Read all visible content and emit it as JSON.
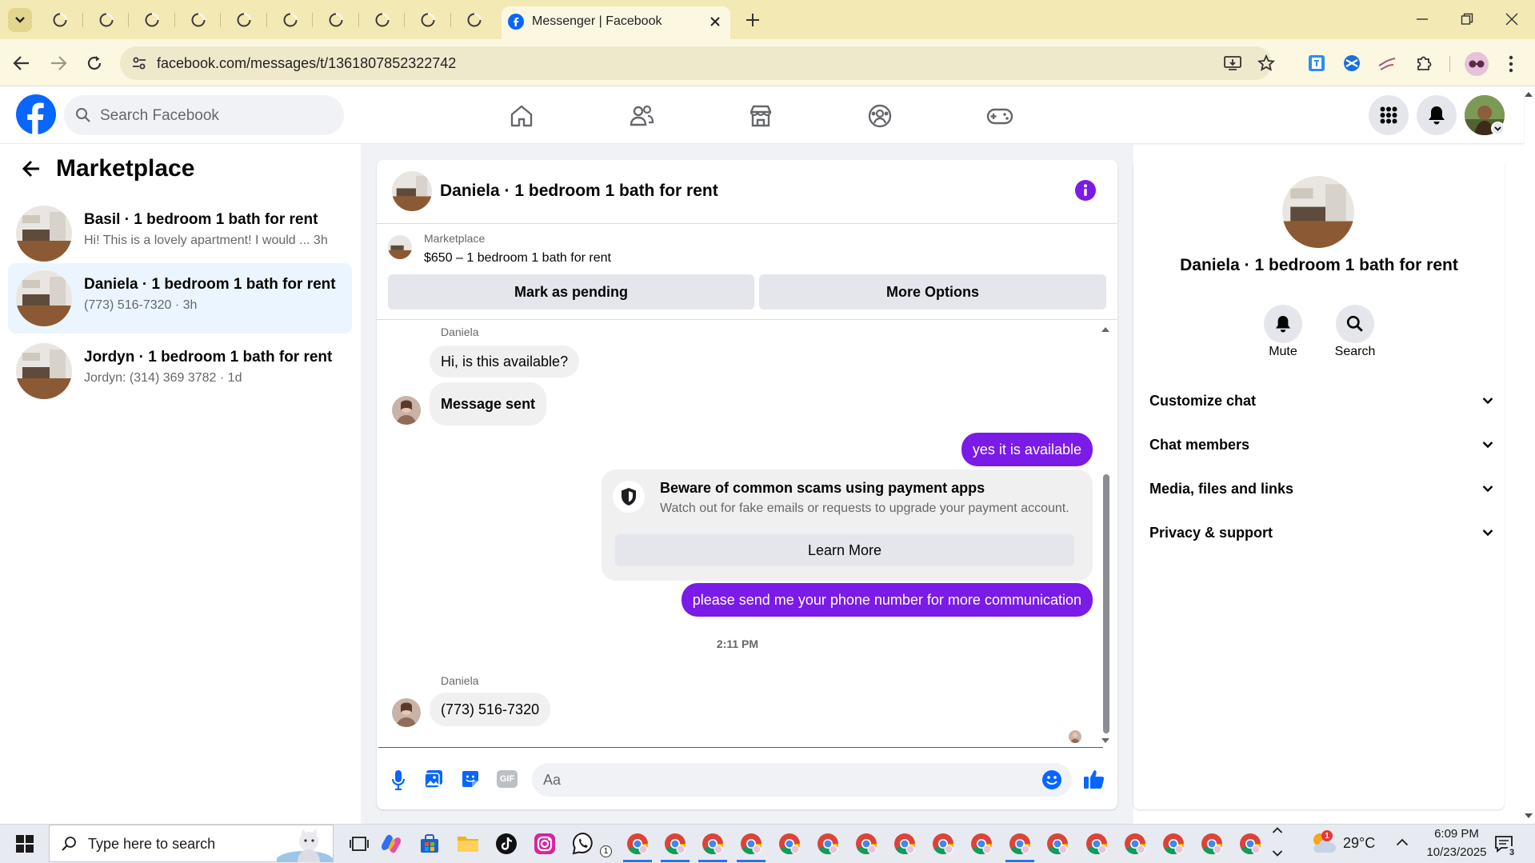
{
  "browser": {
    "active_tab_title": "Messenger | Facebook",
    "url": "facebook.com/messages/t/1361807852322742",
    "background_tab_count": 10
  },
  "fb_header": {
    "search_placeholder": "Search Facebook"
  },
  "left": {
    "title": "Marketplace",
    "conversations": [
      {
        "name": "Basil · 1 bedroom 1 bath for rent",
        "preview": "Hi! This is a lovely apartment! I would ...  3h"
      },
      {
        "name": "Daniela · 1 bedroom 1 bath for rent",
        "preview": "(773) 516-7320 · 3h"
      },
      {
        "name": "Jordyn · 1 bedroom 1 bath for rent",
        "preview": "Jordyn: (314) 369 3782 · 1d"
      }
    ]
  },
  "chat": {
    "title": "Daniela · 1 bedroom 1 bath for rent",
    "listing_source": "Marketplace",
    "listing_text": "$650 – 1 bedroom 1 bath for rent",
    "mark_pending": "Mark as pending",
    "more_options": "More Options",
    "sender1": "Daniela",
    "msg1": "Hi, is this available?",
    "msg2": "Message sent",
    "out1": "yes it is available",
    "scam_title": "Beware of common scams using payment apps",
    "scam_body": "Watch out for fake emails or requests to upgrade your payment account.",
    "learn_more": "Learn More",
    "out2": "please send me your phone number for more communication",
    "timestamp": "2:11 PM",
    "sender2": "Daniela",
    "msg3": "(773) 516-7320",
    "composer_placeholder": "Aa"
  },
  "right": {
    "title": "Daniela · 1 bedroom 1 bath for rent",
    "mute": "Mute",
    "search": "Search",
    "sections": [
      "Customize chat",
      "Chat members",
      "Media, files and links",
      "Privacy & support"
    ]
  },
  "taskbar": {
    "search_placeholder": "Type here to search",
    "weather": "29°C",
    "time": "6:09 PM",
    "date": "10/23/2025",
    "whatsapp_badge": "1",
    "weather_badge": "1",
    "notif_badge": "3"
  },
  "colors": {
    "fb_blue": "#0866ff",
    "messenger_purple": "#7a1be7",
    "chrome_yellow": "#f3e9b4",
    "selected_row": "#ebf5ff"
  }
}
